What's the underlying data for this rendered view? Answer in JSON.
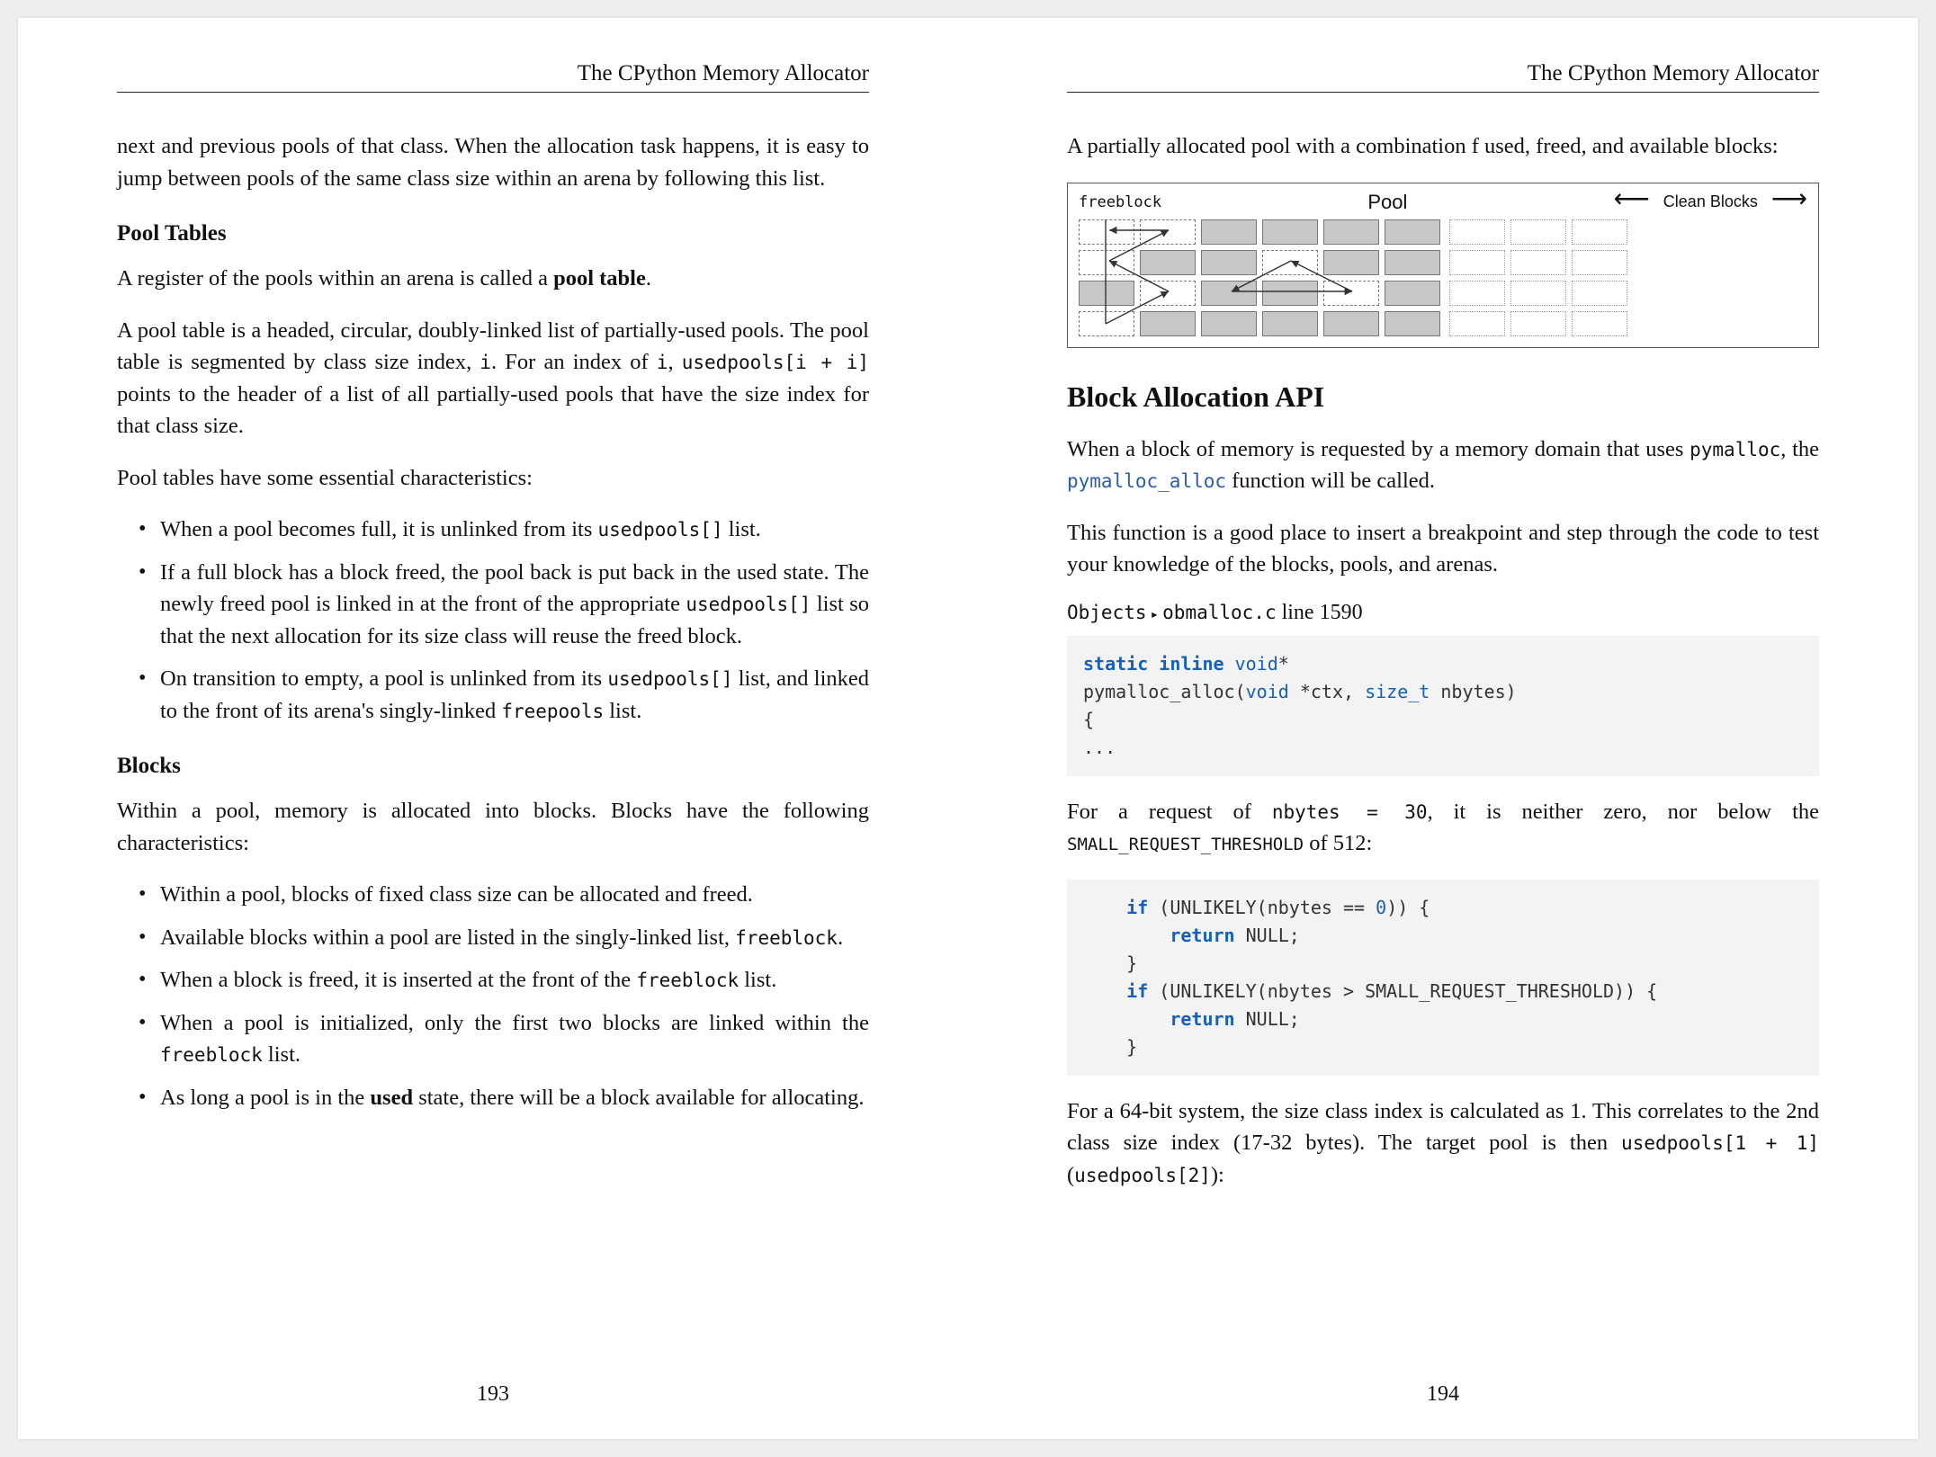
{
  "left": {
    "header": "The CPython Memory Allocator",
    "intro": "next and previous pools of that class. When the allocation task happens, it is easy to jump between pools of the same class size within an arena by following this list.",
    "pool_tables": {
      "head": "Pool Tables",
      "p1_a": "A register of the pools within an arena is called a ",
      "p1_b": "pool table",
      "p1_c": ".",
      "p2_a": "A pool table is a headed, circular, doubly-linked list of partially-used pools. The pool table is segmented by class size index, ",
      "p2_i": "i",
      "p2_b": ". For an index of ",
      "p2_i2": "i",
      "p2_c": ", ",
      "p2_code": "usedpools[i + i]",
      "p2_d": " points to the header of a list of all partially-used pools that have the size index for that class size.",
      "p3": "Pool tables have some essential characteristics:",
      "bullets": [
        {
          "a": "When a pool becomes full, it is unlinked from its ",
          "code": "usedpools[]",
          "b": " list."
        },
        {
          "a": "If a full block has a block freed, the pool back is put back in the used state. The newly freed pool is linked in at the front of the appropriate ",
          "code": "usedpools[]",
          "b": " list so that the next allocation for its size class will reuse the freed block."
        },
        {
          "a": "On transition to empty, a pool is unlinked from its ",
          "code": "usedpools[]",
          "b": " list, and linked to the front of its arena's singly-linked ",
          "code2": "freepools",
          "c": " list."
        }
      ]
    },
    "blocks": {
      "head": "Blocks",
      "p1": "Within a pool, memory is allocated into blocks. Blocks have the following characteristics:",
      "bullets": [
        {
          "text": "Within a pool, blocks of fixed class size can be allocated and freed."
        },
        {
          "a": "Available blocks within a pool are listed in the singly-linked list, ",
          "code": "freeblock",
          "b": "."
        },
        {
          "a": "When a block is freed, it is inserted at the front of the ",
          "code": "freeblock",
          "b": " list."
        },
        {
          "a": "When a pool is initialized, only the first two blocks are linked within the ",
          "code": "freeblock",
          "b": " list."
        },
        {
          "a": "As long a pool is in the ",
          "bold": "used",
          "b": " state, there will be a block available for allocating."
        }
      ]
    },
    "page_num": "193"
  },
  "right": {
    "header": "The CPython Memory Allocator",
    "intro": "A partially allocated pool with a combination f used, freed, and available blocks:",
    "diagram": {
      "freeblock": "freeblock",
      "title": "Pool",
      "clean": "Clean Blocks"
    },
    "api": {
      "head": "Block Allocation API",
      "p1_a": "When a block of memory is requested by a memory domain that uses ",
      "p1_code1": "pymalloc",
      "p1_b": ", the ",
      "p1_link": "pymalloc_alloc",
      "p1_c": " function will be called.",
      "p2": "This function is a good place to insert a breakpoint and step through the code to test your knowledge of the blocks, pools, and arenas.",
      "path_a": "Objects",
      "path_b": "obmalloc.c",
      "path_line": " line 1590",
      "code1": "static inline void*\npymalloc_alloc(void *ctx, size_t nbytes)\n{\n...",
      "p3_a": "For a request of ",
      "p3_code": "nbytes = 30",
      "p3_b": ", it is neither zero, nor below the ",
      "p3_sc": "SMALL_REQUEST_THRESHOLD",
      "p3_c": " of 512:",
      "code2": "    if (UNLIKELY(nbytes == 0)) {\n        return NULL;\n    }\n    if (UNLIKELY(nbytes > SMALL_REQUEST_THRESHOLD)) {\n        return NULL;\n    }",
      "p4_a": "For a 64-bit system, the size class index is calculated as 1. This correlates to the 2nd class size index (17-32 bytes). The target pool is then ",
      "p4_code1": "usedpools[1 + 1]",
      "p4_b": " (",
      "p4_code2": "usedpools[2]",
      "p4_c": "):"
    },
    "page_num": "194"
  }
}
